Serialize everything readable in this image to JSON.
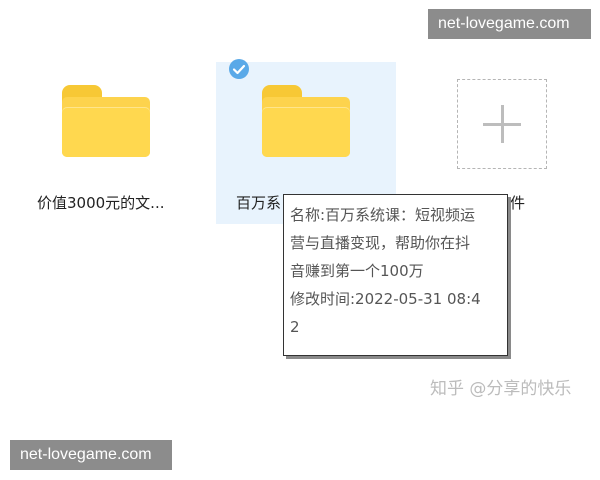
{
  "watermarks": {
    "top": "net-lovegame.com",
    "bottom": "net-lovegame.com"
  },
  "files": [
    {
      "label": "价值3000元的文...",
      "selected": false
    },
    {
      "label": "百万系",
      "selected": true
    },
    {
      "label": "文件",
      "selected": false
    }
  ],
  "tooltip": {
    "lines": [
      "名称:百万系统课：短视频运",
      "营与直播变现，帮助你在抖",
      "音赚到第一个100万",
      "修改时间:2022-05-31 08:4",
      "2"
    ]
  },
  "source_credit": "知乎 @分享的快乐",
  "colors": {
    "folder_yellow": "#fdd34d",
    "selection_bg": "#e8f3fd",
    "check_blue": "#5aa9e8"
  },
  "icons": {
    "folder": "folder-icon",
    "check": "check-circle-icon",
    "add": "plus-icon"
  }
}
